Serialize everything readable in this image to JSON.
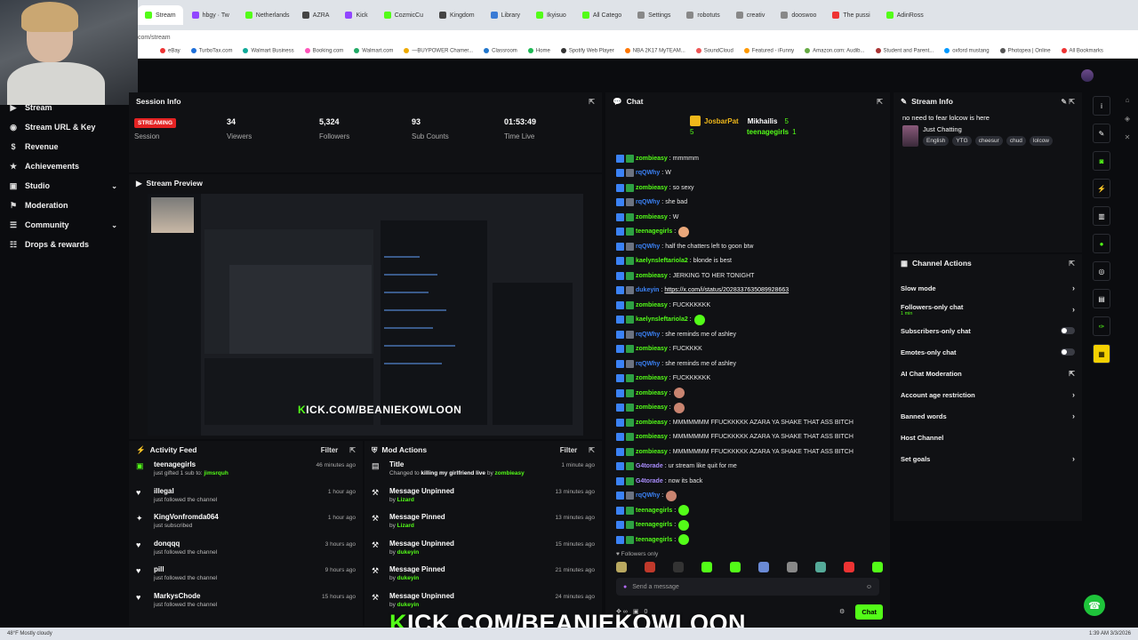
{
  "browser": {
    "tabs": [
      {
        "label": "Stream",
        "color": "#53fc18",
        "active": true
      },
      {
        "label": "hbgy · Tw",
        "color": "#9146ff"
      },
      {
        "label": "Netherlands",
        "color": "#53fc18"
      },
      {
        "label": "AZRA",
        "color": "#444"
      },
      {
        "label": "Kick",
        "color": "#9146ff"
      },
      {
        "label": "CozmicCu",
        "color": "#53fc18"
      },
      {
        "label": "Kingdom",
        "color": "#444"
      },
      {
        "label": "Library",
        "color": "#3a7bd5"
      },
      {
        "label": "Ikyisuo",
        "color": "#53fc18"
      },
      {
        "label": "All Catego",
        "color": "#53fc18"
      },
      {
        "label": "Settings",
        "color": "#888"
      },
      {
        "label": "robotuts",
        "color": "#888"
      },
      {
        "label": "creativ",
        "color": "#888"
      },
      {
        "label": "dooswoo",
        "color": "#888"
      },
      {
        "label": "The pussi",
        "color": "#e33"
      },
      {
        "label": "AdinRoss",
        "color": "#53fc18"
      }
    ],
    "address": "com/stream",
    "bookmarks": [
      "eBay",
      "TurboTax.com",
      "Walmart Business",
      "Booking.com",
      "Walmart.com",
      "—BUYPOWER Chamer...",
      "Classroom",
      "Home",
      "Spotify Web Player",
      "NBA 2K17 MyTEAM...",
      "SoundCloud",
      "Featured - iFunny",
      "Amazon.com: Audib...",
      "Student and Parent...",
      "oxford mustang",
      "Photopea | Online",
      "All Bookmarks"
    ]
  },
  "nav": [
    {
      "icon": "▶",
      "label": "Stream"
    },
    {
      "icon": "◉",
      "label": "Stream URL & Key"
    },
    {
      "icon": "$",
      "label": "Revenue"
    },
    {
      "icon": "★",
      "label": "Achievements"
    },
    {
      "icon": "▣",
      "label": "Studio",
      "chevron": "⌄"
    },
    {
      "icon": "⚑",
      "label": "Moderation"
    },
    {
      "icon": "☰",
      "label": "Community",
      "chevron": "⌄"
    },
    {
      "icon": "☷",
      "label": "Drops & rewards"
    }
  ],
  "session": {
    "title": "Session Info",
    "badge": "STREAMING",
    "session_label": "Session",
    "stats": [
      {
        "value": "34",
        "label": "Viewers"
      },
      {
        "value": "5,324",
        "label": "Followers"
      },
      {
        "value": "93",
        "label": "Sub Counts"
      },
      {
        "value": "01:53:49",
        "label": "Time Live"
      }
    ]
  },
  "preview": {
    "title": "Stream Preview",
    "overlay_k": "K",
    "overlay_rest": "ICK.COM/BEANIEKOWLOON"
  },
  "activity": {
    "title": "Activity Feed",
    "filter": "Filter",
    "items": [
      {
        "icon": "▣",
        "green": true,
        "user": "teenagegirls",
        "pre": "just gifted 1 sub to: ",
        "target": "jimsrquh",
        "time": "46 minutes ago"
      },
      {
        "icon": "♥",
        "user": "illegal",
        "pre": "just followed the channel",
        "target": "",
        "time": "1 hour ago"
      },
      {
        "icon": "✦",
        "user": "KingVonfromda064",
        "pre": "just subscribed",
        "target": "",
        "time": "1 hour ago"
      },
      {
        "icon": "♥",
        "user": "donqqq",
        "pre": "just followed the channel",
        "target": "",
        "time": "3 hours ago"
      },
      {
        "icon": "♥",
        "user": "pill",
        "pre": "just followed the channel",
        "target": "",
        "time": "9 hours ago"
      },
      {
        "icon": "♥",
        "user": "MarkysChode",
        "pre": "just followed the channel",
        "target": "",
        "time": "15 hours ago"
      }
    ]
  },
  "mod": {
    "title": "Mod Actions",
    "filter": "Filter",
    "items": [
      {
        "icon": "▤",
        "action": "Title",
        "pre": "Changed to ",
        "strong": "killing my girlfriend live",
        "mid": " by ",
        "by": "zombieasy",
        "time": "1 minute ago"
      },
      {
        "icon": "⚒",
        "action": "Message Unpinned",
        "pre": "",
        "strong": "",
        "mid": "by ",
        "by": "Lizard",
        "time": "13 minutes ago"
      },
      {
        "icon": "⚒",
        "action": "Message Pinned",
        "pre": "",
        "strong": "",
        "mid": "by ",
        "by": "Lizard",
        "time": "13 minutes ago"
      },
      {
        "icon": "⚒",
        "action": "Message Unpinned",
        "pre": "",
        "strong": "",
        "mid": "by ",
        "by": "dukeyin",
        "time": "15 minutes ago"
      },
      {
        "icon": "⚒",
        "action": "Message Pinned",
        "pre": "",
        "strong": "",
        "mid": "by ",
        "by": "dukeyin",
        "time": "21 minutes ago"
      },
      {
        "icon": "⚒",
        "action": "Message Unpinned",
        "pre": "",
        "strong": "",
        "mid": "by ",
        "by": "dukeyin",
        "time": "24 minutes ago"
      }
    ]
  },
  "chat": {
    "title": "Chat",
    "pinned_top": [
      "JosbarPat",
      "5",
      "Mikhailis",
      "5"
    ],
    "pinned_bottom": [
      "teenagegirls",
      "1"
    ],
    "messages": [
      {
        "user": "zombieasy",
        "color": "#53fc18",
        "text": "mmmmm"
      },
      {
        "user": "rqQWhy",
        "color": "#3b82f6",
        "text": "W"
      },
      {
        "user": "zombieasy",
        "color": "#53fc18",
        "text": "so sexy"
      },
      {
        "user": "rqQWhy",
        "color": "#3b82f6",
        "text": "she bad"
      },
      {
        "user": "zombieasy",
        "color": "#53fc18",
        "text": "W"
      },
      {
        "user": "teenagegirls",
        "color": "#53fc18",
        "text": "",
        "emote": "#e9a77a"
      },
      {
        "user": "rqQWhy",
        "color": "#3b82f6",
        "text": "half the chatters left to goon btw"
      },
      {
        "user": "kaelynsleftariola2",
        "color": "#53fc18",
        "text": "blonde is best"
      },
      {
        "user": "zombieasy",
        "color": "#53fc18",
        "text": "JERKING TO HER TONIGHT"
      },
      {
        "user": "dukeyin",
        "color": "#3b82f6",
        "text": "",
        "link": "https://x.com/i/status/2028337635089928663"
      },
      {
        "user": "zombieasy",
        "color": "#53fc18",
        "text": "FUCKKKKKK"
      },
      {
        "user": "kaelynsleftariola2",
        "color": "#53fc18",
        "text": "",
        "emote": "#53fc18"
      },
      {
        "user": "rqQWhy",
        "color": "#3b82f6",
        "text": "she reminds me of ashley"
      },
      {
        "user": "zombieasy",
        "color": "#53fc18",
        "text": "FUCKKKK"
      },
      {
        "user": "rqQWhy",
        "color": "#3b82f6",
        "text": "she reminds me of ashley"
      },
      {
        "user": "zombieasy",
        "color": "#53fc18",
        "text": "FUCKKKKKK"
      },
      {
        "user": "zombieasy",
        "color": "#53fc18",
        "text": "",
        "emote": "#c98470"
      },
      {
        "user": "zombieasy",
        "color": "#53fc18",
        "text": "",
        "emote": "#c98470"
      },
      {
        "user": "zombieasy",
        "color": "#53fc18",
        "text": "MMMMMMM FFUCKKKKK AZARA YA SHAKE THAT ASS BITCH"
      },
      {
        "user": "zombieasy",
        "color": "#53fc18",
        "text": "MMMMMMM FFUCKKKKK AZARA YA SHAKE THAT ASS BITCH"
      },
      {
        "user": "zombieasy",
        "color": "#53fc18",
        "text": "MMMMMMM FFUCKKKKK AZARA YA SHAKE THAT ASS BITCH"
      },
      {
        "user": "G4torade",
        "color": "#a78bfa",
        "text": "ur stream like quit for me"
      },
      {
        "user": "G4torade",
        "color": "#a78bfa",
        "text": "now its back"
      },
      {
        "user": "rqQWhy",
        "color": "#3b82f6",
        "text": "",
        "emote": "#c98470"
      },
      {
        "user": "teenagegirls",
        "color": "#53fc18",
        "text": "",
        "emote": "#53fc18"
      },
      {
        "user": "teenagegirls",
        "color": "#53fc18",
        "text": "",
        "emote": "#53fc18"
      },
      {
        "user": "teenagegirls",
        "color": "#53fc18",
        "text": "",
        "emote": "#53fc18"
      }
    ],
    "followers_only": "Followers only",
    "emote_colors": [
      "#b9a860",
      "#c0392b",
      "#333",
      "#53fc18",
      "#53fc18",
      "#6a8ad5",
      "#888",
      "#5a9",
      "#e33",
      "#53fc18"
    ],
    "placeholder": "Send a message",
    "footer_count": "0",
    "send_label": "Chat"
  },
  "streaminfo": {
    "title": "Stream Info",
    "stream_title": "no need to fear lolcow is here",
    "category": "Just Chatting",
    "tags": [
      "English",
      "YTG",
      "cheesur",
      "chud",
      "lolcow"
    ]
  },
  "actions": {
    "title": "Channel Actions",
    "items": [
      {
        "label": "Slow mode",
        "type": "arrow"
      },
      {
        "label": "Followers-only chat",
        "sub": "1 min",
        "type": "arrow"
      },
      {
        "label": "Subscribers-only chat",
        "type": "toggle"
      },
      {
        "label": "Emotes-only chat",
        "type": "toggle"
      },
      {
        "label": "AI Chat Moderation",
        "type": "external"
      },
      {
        "label": "Account age restriction",
        "type": "arrow"
      },
      {
        "label": "Banned words",
        "type": "arrow"
      },
      {
        "label": "Host Channel",
        "type": "none"
      },
      {
        "label": "Set goals",
        "type": "arrow"
      }
    ]
  },
  "overlay": {
    "k": "K",
    "rest": "ICK.COM/BEANIEKOWLOON"
  },
  "taskbar": {
    "weather": "48°F",
    "weather_sub": "Mostly cloudy",
    "clock": "1:39 AM",
    "date": "3/3/2026"
  },
  "colors": {
    "accent": "#53fc18",
    "bg": "#0b0c0f",
    "panel": "#101114",
    "live": "#e42323"
  }
}
